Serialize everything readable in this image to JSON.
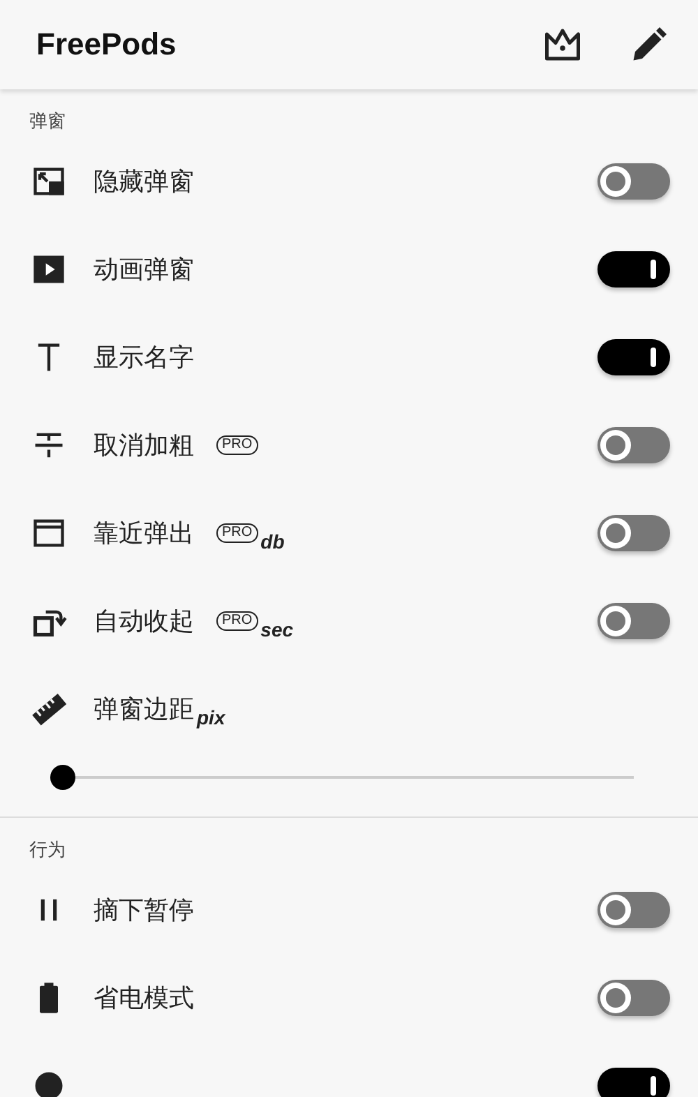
{
  "app_bar": {
    "title": "FreePods"
  },
  "sections": [
    {
      "title": "弹窗",
      "items": [
        {
          "kind": "toggle",
          "label": "隐藏弹窗",
          "on": false
        },
        {
          "kind": "toggle",
          "label": "动画弹窗",
          "on": true
        },
        {
          "kind": "toggle",
          "label": "显示名字",
          "on": true
        },
        {
          "kind": "toggle",
          "label": "取消加粗",
          "badge": "PRO",
          "on": false
        },
        {
          "kind": "toggle",
          "label": "靠近弹出",
          "badge": "PRO",
          "unit": "db",
          "on": false
        },
        {
          "kind": "toggle",
          "label": "自动收起",
          "badge": "PRO",
          "unit": "sec",
          "on": false
        },
        {
          "kind": "slider",
          "label": "弹窗边距",
          "unit": "pix",
          "level": 0
        }
      ]
    },
    {
      "title": "行为",
      "items": [
        {
          "kind": "toggle",
          "label": "摘下暂停",
          "on": false
        },
        {
          "kind": "toggle",
          "label": "省电模式",
          "on": false
        },
        {
          "kind": "toggle",
          "on": true
        }
      ]
    }
  ]
}
